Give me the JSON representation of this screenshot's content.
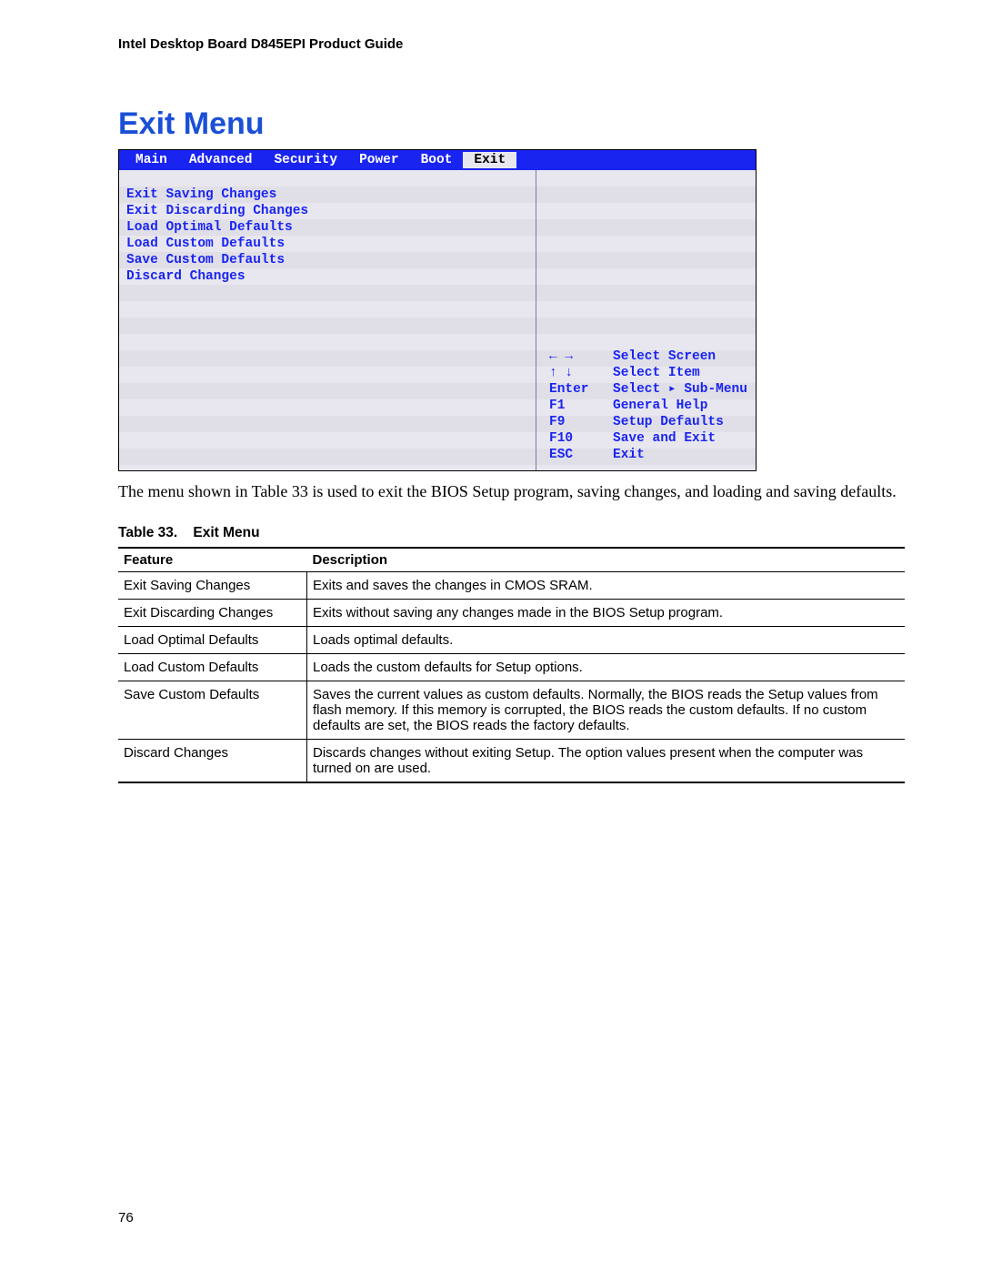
{
  "doc_header": "Intel Desktop Board D845EPI Product Guide",
  "section_title": "Exit Menu",
  "bios": {
    "tabs": [
      "Main",
      "Advanced",
      "Security",
      "Power",
      "Boot",
      "Exit"
    ],
    "active_tab_index": 5,
    "menu_items": [
      "Exit Saving Changes",
      "Exit Discarding Changes",
      "Load Optimal Defaults",
      "Load Custom Defaults",
      "Save Custom Defaults",
      "Discard Changes"
    ],
    "help": [
      {
        "key": "← →",
        "label": "Select Screen"
      },
      {
        "key": "↑ ↓",
        "label": "Select Item"
      },
      {
        "key": "Enter",
        "label": "Select ▸ Sub-Menu"
      },
      {
        "key": "F1",
        "label": "General Help"
      },
      {
        "key": "F9",
        "label": "Setup Defaults"
      },
      {
        "key": "F10",
        "label": "Save and Exit"
      },
      {
        "key": "ESC",
        "label": "Exit"
      }
    ]
  },
  "paragraph": "The menu shown in Table 33 is used to exit the BIOS Setup program, saving changes, and loading and saving defaults.",
  "table_caption": "Table 33.    Exit Menu",
  "table_headers": {
    "feature": "Feature",
    "description": "Description"
  },
  "table_rows": [
    {
      "feature": "Exit Saving Changes",
      "description": "Exits and saves the changes in CMOS SRAM."
    },
    {
      "feature": "Exit Discarding Changes",
      "description": "Exits without saving any changes made in the BIOS Setup program."
    },
    {
      "feature": "Load Optimal Defaults",
      "description": "Loads optimal defaults."
    },
    {
      "feature": "Load Custom Defaults",
      "description": "Loads the custom defaults for Setup options."
    },
    {
      "feature": "Save Custom Defaults",
      "description": "Saves the current values as custom defaults.  Normally, the BIOS reads the Setup values from flash memory.  If this memory is corrupted, the BIOS reads the custom defaults.  If no custom defaults are set, the BIOS reads the factory defaults."
    },
    {
      "feature": "Discard Changes",
      "description": "Discards changes without exiting Setup.  The option values present when the computer was turned on are used."
    }
  ],
  "page_number": "76"
}
